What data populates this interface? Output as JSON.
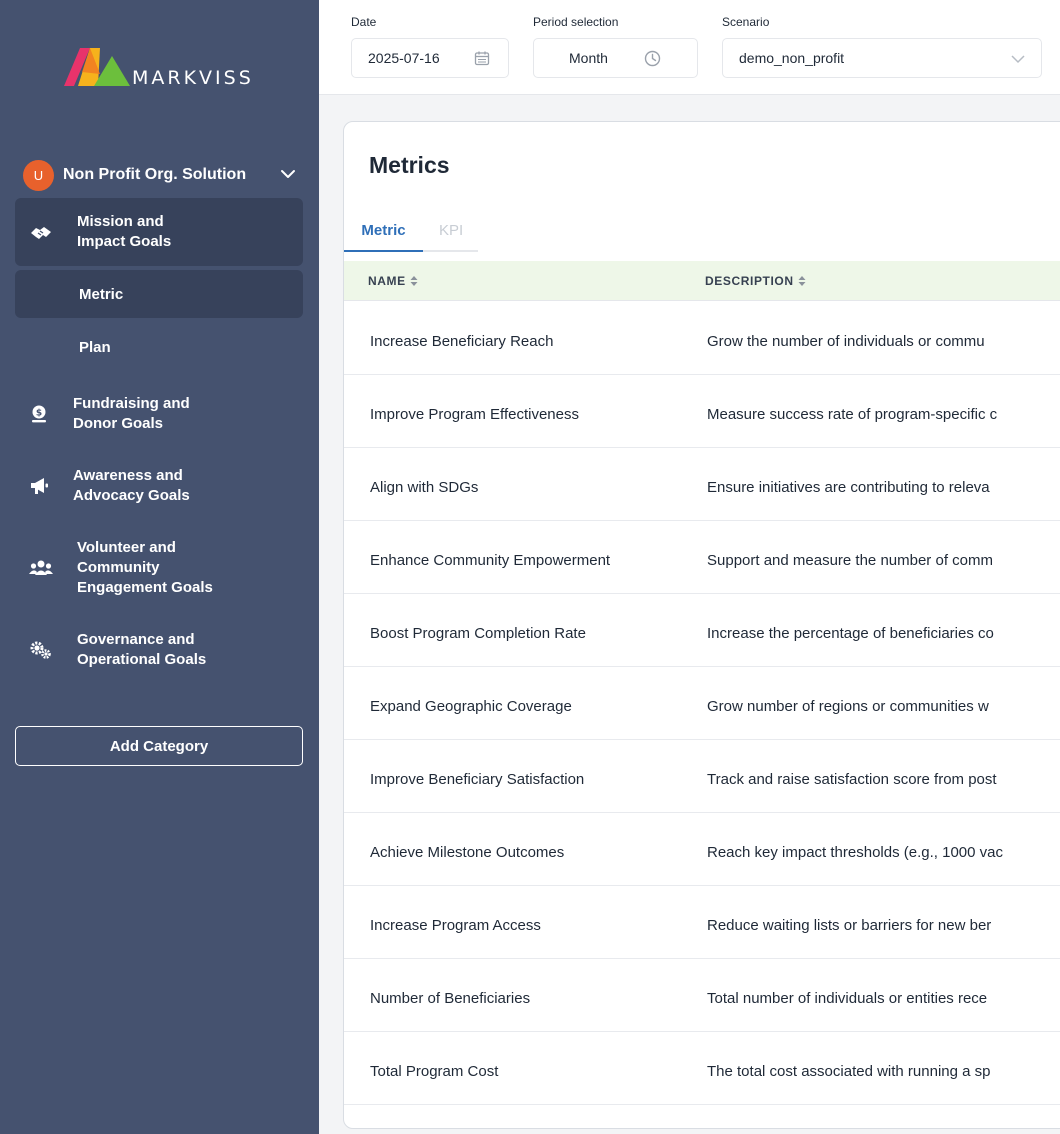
{
  "brand": {
    "name": "MARKVISS"
  },
  "organization": {
    "avatar_initial": "U",
    "name": "Non Profit Org. Solution"
  },
  "sidebar": {
    "categories": [
      {
        "label_line1": "Mission and",
        "label_line2": "Impact Goals",
        "icon": "handshake-icon",
        "active": true
      },
      {
        "label_line1": "Fundraising and",
        "label_line2": "Donor Goals",
        "icon": "money-bag-icon"
      },
      {
        "label_line1": "Awareness and",
        "label_line2": "Advocacy Goals",
        "icon": "megaphone-icon"
      },
      {
        "label_line1": "Volunteer and",
        "label_line2": "Community",
        "label_line3": "Engagement Goals",
        "icon": "users-icon"
      },
      {
        "label_line1": "Governance and",
        "label_line2": "Operational Goals",
        "icon": "gears-icon"
      }
    ],
    "subitems": [
      {
        "label": "Metric",
        "active": true
      },
      {
        "label": "Plan"
      }
    ],
    "add_category_label": "Add Category"
  },
  "topbar": {
    "date": {
      "label": "Date",
      "value": "2025-07-16"
    },
    "period": {
      "label": "Period selection",
      "value": "Month"
    },
    "scenario": {
      "label": "Scenario",
      "value": "demo_non_profit"
    }
  },
  "main": {
    "title": "Metrics",
    "tabs": [
      {
        "label": "Metric",
        "active": true
      },
      {
        "label": "KPI"
      }
    ],
    "table": {
      "columns": [
        "NAME",
        "DESCRIPTION"
      ],
      "rows": [
        {
          "name": "Increase Beneficiary Reach",
          "description": "Grow the number of individuals or commu"
        },
        {
          "name": "Improve Program Effectiveness",
          "description": "Measure success rate of program-specific c"
        },
        {
          "name": "Align with SDGs",
          "description": "Ensure initiatives are contributing to releva"
        },
        {
          "name": "Enhance Community Empowerment",
          "description": "Support and measure the number of comm"
        },
        {
          "name": "Boost Program Completion Rate",
          "description": "Increase the percentage of beneficiaries co"
        },
        {
          "name": "Expand Geographic Coverage",
          "description": "Grow number of regions or communities w"
        },
        {
          "name": "Improve Beneficiary Satisfaction",
          "description": "Track and raise satisfaction score from post"
        },
        {
          "name": "Achieve Milestone Outcomes",
          "description": "Reach key impact thresholds (e.g., 1000 vac"
        },
        {
          "name": "Increase Program Access",
          "description": "Reduce waiting lists or barriers for new ber"
        },
        {
          "name": "Number of Beneficiaries",
          "description": "Total number of individuals or entities rece"
        },
        {
          "name": "Total Program Cost",
          "description": "The total cost associated with running a sp"
        }
      ]
    }
  },
  "colors": {
    "sidebar_bg": "#45526f",
    "sidebar_active": "#37425b",
    "accent_blue": "#2f6fb8",
    "avatar_orange": "#e8612c",
    "table_header_bg": "#eef7e8"
  }
}
